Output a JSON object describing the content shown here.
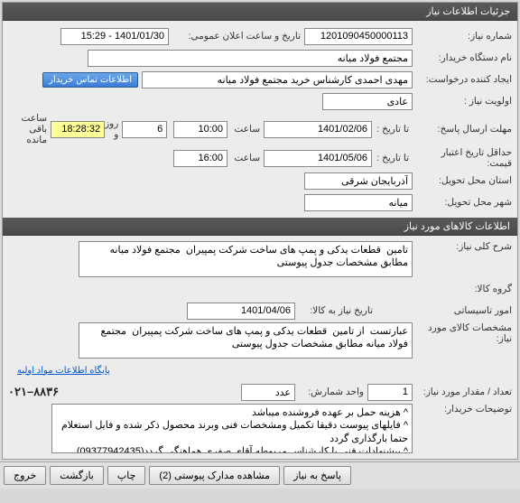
{
  "header": {
    "title": "جزئیات اطلاعات نیاز"
  },
  "info": {
    "need_no_label": "شماره نیاز:",
    "need_no": "1201090450000113",
    "announce_label": "تاریخ و ساعت اعلان عمومی:",
    "announce_value": "1401/01/30 - 15:29",
    "buyer_label": "نام دستگاه خریدار:",
    "buyer_value": "مجتمع فولاد میانه",
    "requester_label": "ایجاد کننده درخواست:",
    "requester_value": "مهدی احمدی کارشناس خرید مجتمع فولاد میانه",
    "contact_btn": "اطلاعات تماس خریدار",
    "priority_label": "اولویت نیاز :",
    "priority_value": "عادی",
    "reply_deadline_label": "مهلت ارسال پاسخ:",
    "until_label": "تا تاریخ :",
    "reply_date": "1401/02/06",
    "time_label": "ساعت",
    "reply_time": "10:00",
    "days_label": "روز و",
    "days_value": "6",
    "countdown": "18:28:32",
    "remaining_label": "ساعت باقی مانده",
    "price_valid_label": "حداقل تاریخ اعتبار قیمت:",
    "price_valid_date": "1401/05/06",
    "price_valid_time": "16:00",
    "loc_province_label": "استان محل تحویل:",
    "loc_province": "آذربایجان شرقی",
    "loc_city_label": "شهر محل تحویل:",
    "loc_city": "میانه"
  },
  "goods": {
    "panel_title": "اطلاعات کالاهای مورد نیاز",
    "summary_label": "شرح کلی نیاز:",
    "summary_value": "تامین  قطعات یدکی و پمپ های ساخت شرکت پمپیران  مجتمع فولاد میانه مطابق مشخصات جدول پیوستی",
    "group_label": "گروه کالا:",
    "establish_label": "امور تاسیساتی",
    "need_date_label": "تاریخ نیاز به کالا:",
    "need_date": "1401/04/06",
    "spec_label": "مشخصات کالای مورد نیاز:",
    "spec_value": "عبارتست  از تامین  قطعات یدکی و پمپ های ساخت شرکت پمپیران  مجتمع فولاد میانه مطابق مشخصات جدول پیوستی",
    "app_link": "پایگاه اطلاعات مواد اولیه",
    "qty_label": "تعداد / مقدار مورد نیاز:",
    "qty_value": "1",
    "unit_label": "واحد شمارش:",
    "unit_value": "عدد",
    "phone_label": "۸۸۳۶–۰۲۱",
    "notes_label": "توضیحات خریدار:",
    "notes_value": "^ هزینه حمل بر عهده فروشنده میباشد\n^ فایلهای پیوست دقیقا تکمیل ومشخصات فنی وبرند محصول ذکر شده و فایل استعلام حتما بارگذاری گردد\n^ پیشنهادات فنی با کارشناس مربوطه آقای صفری هماهنگی گردد(09377942435)"
  },
  "footer": {
    "reply": "پاسخ به نیاز",
    "attachments": "مشاهده مدارک پیوستی (2)",
    "print": "چاپ",
    "back": "بازگشت",
    "exit": "خروج"
  }
}
